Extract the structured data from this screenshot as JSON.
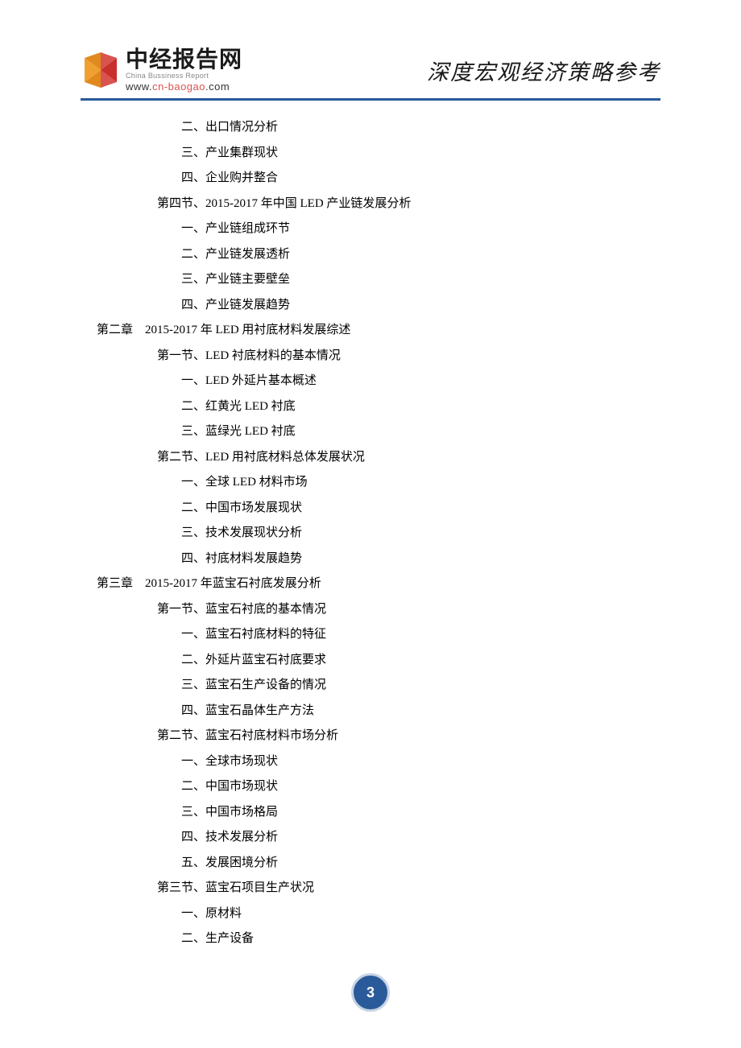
{
  "header": {
    "logo_cn": "中经报告网",
    "logo_en": "China Bussiness Report",
    "logo_url_w": "www.",
    "logo_url_c": "cn-baogao",
    "logo_url_b": ".com",
    "tagline": "深度宏观经济策略参考"
  },
  "toc": [
    {
      "level": 4,
      "text": "二、出口情况分析"
    },
    {
      "level": 4,
      "text": "三、产业集群现状"
    },
    {
      "level": 4,
      "text": "四、企业购并整合"
    },
    {
      "level": 3,
      "text": "第四节、2015-2017 年中国 LED 产业链发展分析"
    },
    {
      "level": 4,
      "text": "一、产业链组成环节"
    },
    {
      "level": 4,
      "text": "二、产业链发展透析"
    },
    {
      "level": 4,
      "text": "三、产业链主要壁垒"
    },
    {
      "level": 4,
      "text": "四、产业链发展趋势"
    },
    {
      "level": 1,
      "text": "第二章　2015-2017 年 LED 用衬底材料发展综述"
    },
    {
      "level": 3,
      "text": "第一节、LED 衬底材料的基本情况"
    },
    {
      "level": 4,
      "text": "一、LED 外延片基本概述"
    },
    {
      "level": 4,
      "text": "二、红黄光 LED 衬底"
    },
    {
      "level": 4,
      "text": "三、蓝绿光 LED 衬底"
    },
    {
      "level": 3,
      "text": "第二节、LED 用衬底材料总体发展状况"
    },
    {
      "level": 4,
      "text": "一、全球 LED 材料市场"
    },
    {
      "level": 4,
      "text": "二、中国市场发展现状"
    },
    {
      "level": 4,
      "text": "三、技术发展现状分析"
    },
    {
      "level": 4,
      "text": "四、衬底材料发展趋势"
    },
    {
      "level": 1,
      "text": "第三章　2015-2017 年蓝宝石衬底发展分析"
    },
    {
      "level": 3,
      "text": "第一节、蓝宝石衬底的基本情况"
    },
    {
      "level": 4,
      "text": "一、蓝宝石衬底材料的特征"
    },
    {
      "level": 4,
      "text": "二、外延片蓝宝石衬底要求"
    },
    {
      "level": 4,
      "text": "三、蓝宝石生产设备的情况"
    },
    {
      "level": 4,
      "text": "四、蓝宝石晶体生产方法"
    },
    {
      "level": 3,
      "text": "第二节、蓝宝石衬底材料市场分析"
    },
    {
      "level": 4,
      "text": "一、全球市场现状"
    },
    {
      "level": 4,
      "text": "二、中国市场现状"
    },
    {
      "level": 4,
      "text": "三、中国市场格局"
    },
    {
      "level": 4,
      "text": "四、技术发展分析"
    },
    {
      "level": 4,
      "text": "五、发展困境分析"
    },
    {
      "level": 3,
      "text": "第三节、蓝宝石项目生产状况"
    },
    {
      "level": 4,
      "text": "一、原材料"
    },
    {
      "level": 4,
      "text": "二、生产设备"
    }
  ],
  "page_number": "3"
}
